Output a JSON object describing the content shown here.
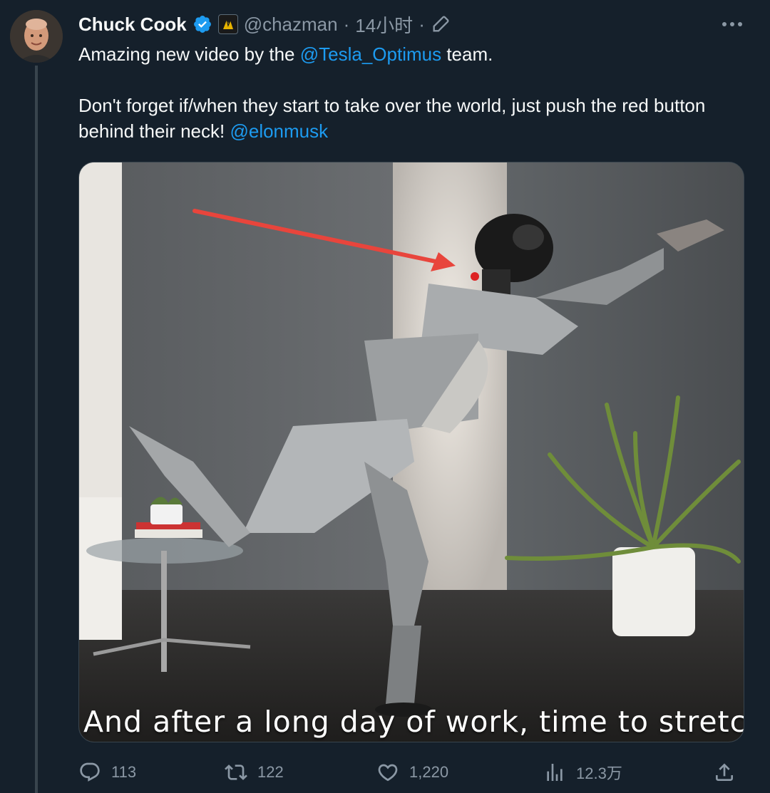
{
  "author": {
    "display_name": "Chuck Cook",
    "handle": "@chazman",
    "separator": "·",
    "timestamp": "14小时",
    "verified_icon": "verified-badge-icon",
    "affiliation_icon": "affiliation-badge-icon"
  },
  "tweet": {
    "line1_before": "Amazing new video by the ",
    "line1_mention": "@Tesla_Optimus",
    "line1_after": " team.",
    "line2_text": "Don't forget if/when they start to take over the world, just push the red button behind their neck! ",
    "line2_mention": "@elonmusk"
  },
  "media": {
    "caption": "And after a long day of work, time to stretch!"
  },
  "actions": {
    "replies": "113",
    "retweets": "122",
    "likes": "1,220",
    "views": "12.3万"
  },
  "colors": {
    "background": "#15202b",
    "accent": "#1d9bf0",
    "muted": "#8b98a5"
  }
}
